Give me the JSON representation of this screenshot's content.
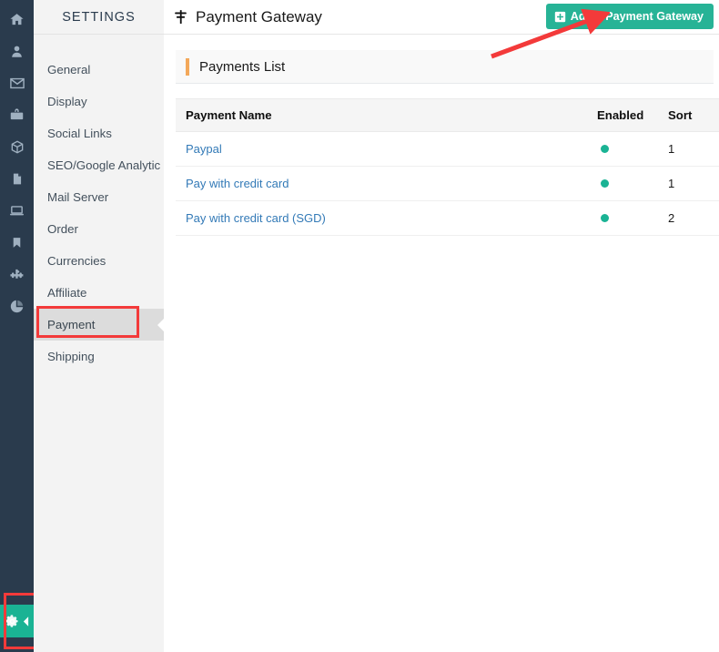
{
  "rail": {
    "icons": [
      {
        "name": "home-icon"
      },
      {
        "name": "user-icon"
      },
      {
        "name": "envelope-icon"
      },
      {
        "name": "briefcase-icon"
      },
      {
        "name": "box-icon"
      },
      {
        "name": "file-icon"
      },
      {
        "name": "laptop-icon"
      },
      {
        "name": "bookmark-icon"
      },
      {
        "name": "puzzle-icon"
      },
      {
        "name": "pie-chart-icon"
      }
    ],
    "gear_icon": "gear-icon",
    "collapse_icon": "chevron-left-icon",
    "accent_color": "#1ab394",
    "background_color": "#2a3b4d"
  },
  "sidebar": {
    "title": "SETTINGS",
    "items": [
      {
        "label": "General",
        "active": false
      },
      {
        "label": "Display",
        "active": false
      },
      {
        "label": "Social Links",
        "active": false
      },
      {
        "label": "SEO/Google Analytic",
        "active": false
      },
      {
        "label": "Mail Server",
        "active": false
      },
      {
        "label": "Order",
        "active": false
      },
      {
        "label": "Currencies",
        "active": false
      },
      {
        "label": "Affiliate",
        "active": false
      },
      {
        "label": "Payment",
        "active": true
      },
      {
        "label": "Shipping",
        "active": false
      }
    ],
    "background_color": "#f3f3f3",
    "active_background_color": "#dcdcdc"
  },
  "header": {
    "icon": "sliders-icon",
    "title": "Payment Gateway",
    "add_button": {
      "label": "Add a Payment Gateway",
      "icon": "plus-square-icon",
      "color": "#27b396"
    }
  },
  "panel": {
    "title": "Payments List",
    "accent_color": "#f3a85a"
  },
  "table": {
    "columns": [
      "Payment Name",
      "Enabled",
      "Sort"
    ],
    "rows": [
      {
        "name": "Paypal",
        "enabled": true,
        "sort": "1"
      },
      {
        "name": "Pay with credit card",
        "enabled": true,
        "sort": "1"
      },
      {
        "name": "Pay with credit card (SGD)",
        "enabled": true,
        "sort": "2"
      }
    ],
    "enabled_dot_color": "#1ab394",
    "link_color": "#337ab7"
  },
  "annotations": {
    "arrow_color": "#f33a3a",
    "box_color": "#f33a3a",
    "arrow_target": "Add a Payment Gateway",
    "box_targets": [
      "Payment",
      "gear-icon"
    ]
  }
}
